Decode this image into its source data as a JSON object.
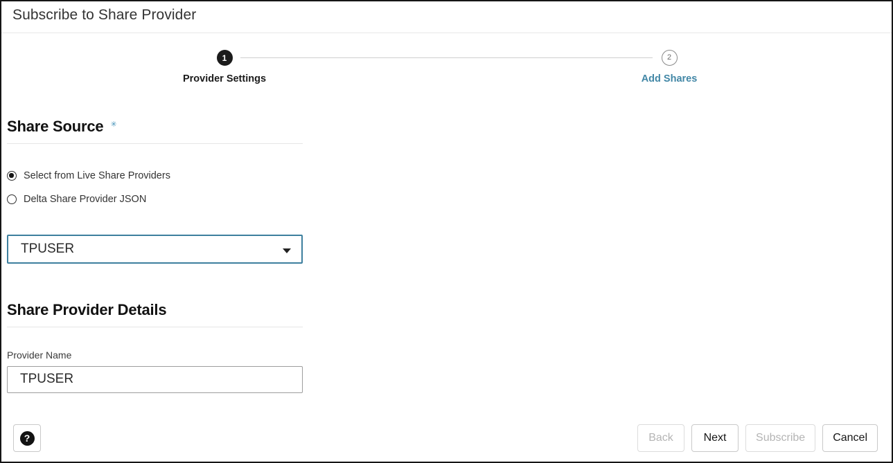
{
  "window": {
    "title": "Subscribe to Share Provider"
  },
  "stepper": {
    "steps": [
      {
        "number": "1",
        "label": "Provider Settings",
        "state": "active"
      },
      {
        "number": "2",
        "label": "Add Shares",
        "state": "upcoming"
      }
    ],
    "active_color": "#1b1b1b",
    "upcoming_color": "#4287a6",
    "connector_color": "#cfcfcf"
  },
  "share_source": {
    "heading": "Share Source",
    "required_marker": "✳",
    "required_color": "#4a96bb",
    "options": [
      {
        "label": "Select from Live Share Providers",
        "checked": true
      },
      {
        "label": "Delta Share Provider JSON",
        "checked": false
      }
    ],
    "provider_select": {
      "value": "TPUSER",
      "caret_icon": "chevron-down-icon",
      "focused": true,
      "border_color": "#3d7f9e"
    }
  },
  "provider_details": {
    "heading": "Share Provider Details",
    "provider_name": {
      "label": "Provider Name",
      "value": "TPUSER"
    }
  },
  "footer": {
    "help": {
      "icon": "help-icon",
      "glyph": "?"
    },
    "buttons": [
      {
        "label": "Back",
        "enabled": false
      },
      {
        "label": "Next",
        "enabled": true
      },
      {
        "label": "Subscribe",
        "enabled": false
      },
      {
        "label": "Cancel",
        "enabled": true
      }
    ]
  }
}
